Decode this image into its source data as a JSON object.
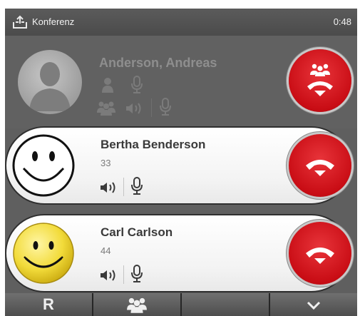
{
  "header": {
    "title": "Konferenz",
    "timer": "0:48",
    "share_icon": "share-icon"
  },
  "participants": [
    {
      "name": "Anderson, Andreas",
      "number": "",
      "role": "host",
      "muted_style": true
    },
    {
      "name": "Bertha Benderson",
      "number": "33",
      "role": "guest"
    },
    {
      "name": "Carl Carlson",
      "number": "44",
      "role": "guest"
    }
  ],
  "bottom_bar": {
    "r_label": "R",
    "buttons": [
      "r-button",
      "conference-button",
      "empty-button",
      "chevron-down-button"
    ]
  },
  "colors": {
    "hangup_red": "#d0121a",
    "background": "#5f5f5f",
    "header": "#4f4f4f"
  }
}
